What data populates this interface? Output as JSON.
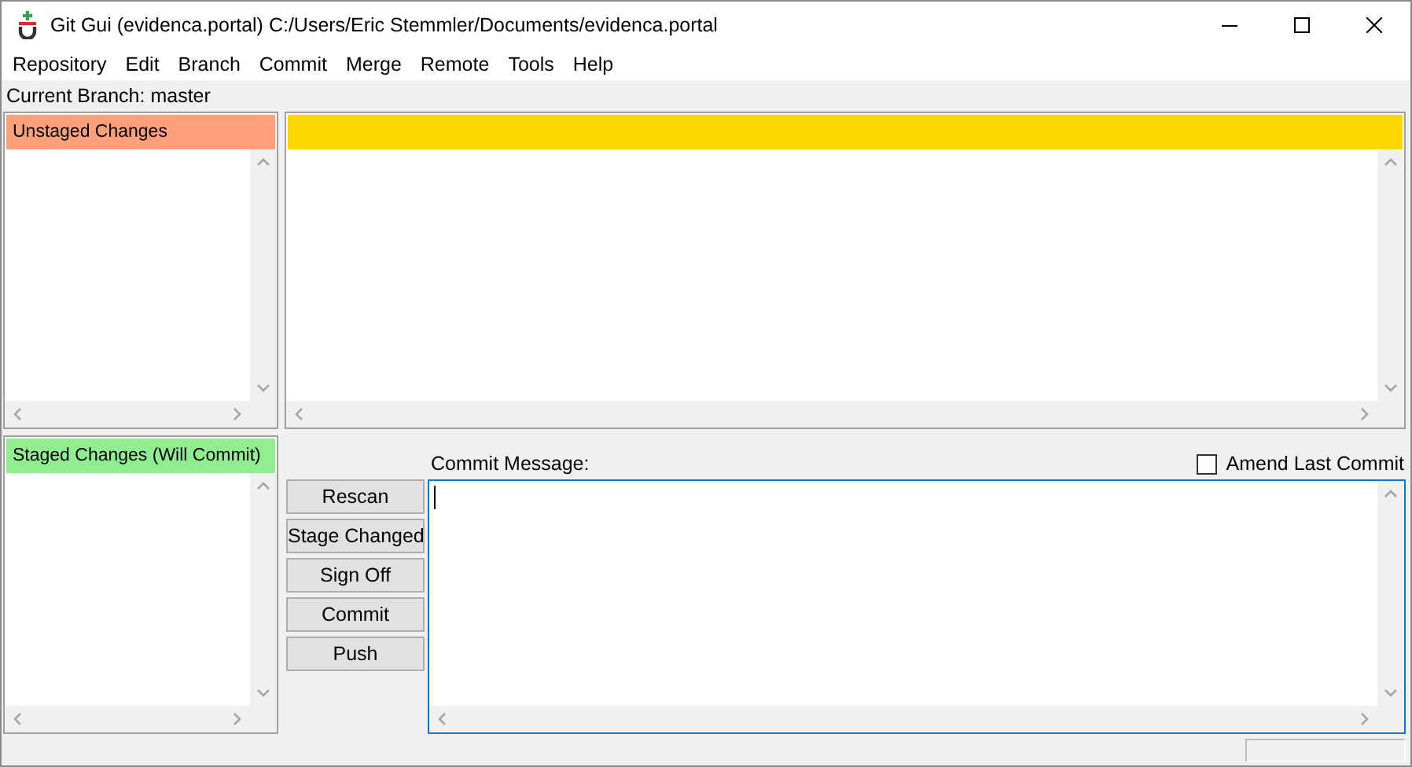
{
  "window": {
    "title": "Git Gui (evidenca.portal) C:/Users/Eric Stemmler/Documents/evidenca.portal"
  },
  "menu": [
    "Repository",
    "Edit",
    "Branch",
    "Commit",
    "Merge",
    "Remote",
    "Tools",
    "Help"
  ],
  "current_branch": "Current Branch: master",
  "unstaged": {
    "title": "Unstaged Changes"
  },
  "staged": {
    "title": "Staged Changes (Will Commit)"
  },
  "buttons": [
    "Rescan",
    "Stage Changed",
    "Sign Off",
    "Commit",
    "Push"
  ],
  "commit_message": {
    "label": "Commit Message:"
  },
  "amend": {
    "label": "Amend Last Commit",
    "checked": false
  }
}
